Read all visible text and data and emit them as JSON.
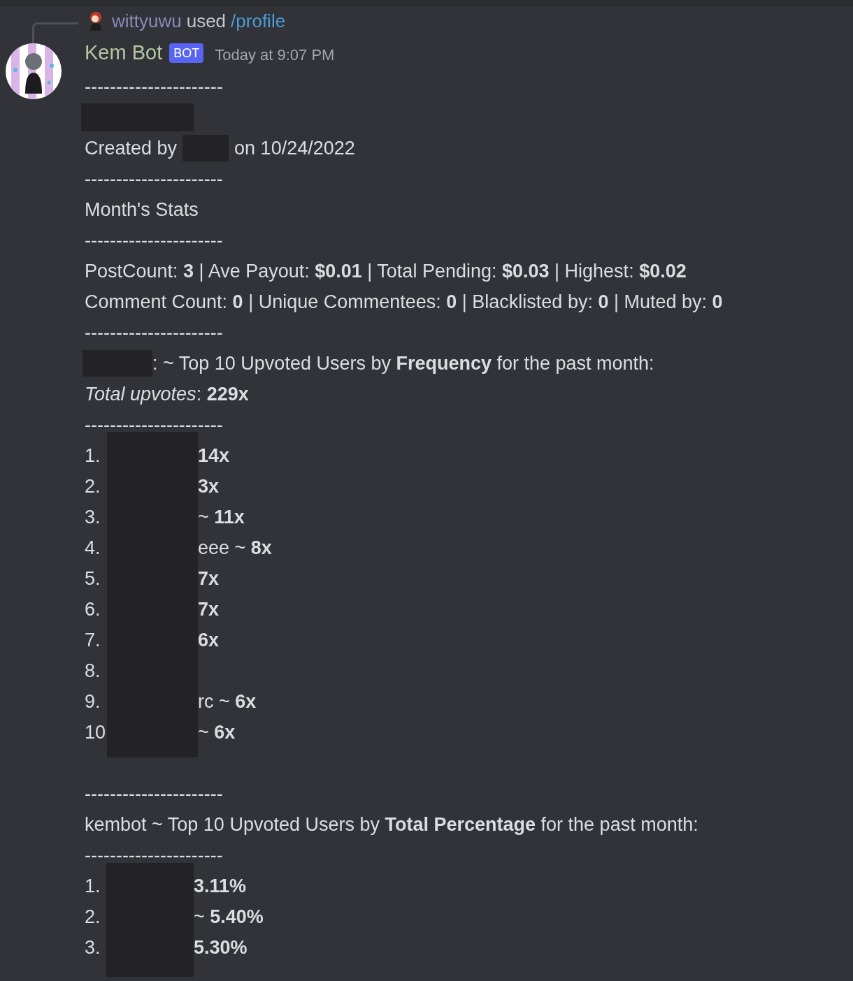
{
  "reply": {
    "username": "wittyuwu",
    "action": "used",
    "command": "/profile"
  },
  "message": {
    "author": "Kem Bot",
    "badge": "BOT",
    "timestamp": "Today at 9:07 PM"
  },
  "lines": [
    {
      "kind": "text",
      "text": "----------------------"
    },
    {
      "kind": "redacted"
    },
    {
      "kind": "split",
      "before": "Created by",
      "after": "on 10/24/2022"
    },
    {
      "kind": "text",
      "text": "----------------------"
    },
    {
      "kind": "text",
      "text": "Month's Stats"
    },
    {
      "kind": "text",
      "text": "----------------------"
    },
    {
      "kind": "text",
      "text": "PostCount: **3** | Ave Payout: **$0.01** | Total Pending: **$0.03** | Highest: **$0.02**"
    },
    {
      "kind": "text",
      "text": "Comment Count: **0** | Unique Commentees: **0** | Blacklisted by: **0** | Muted by: **0**"
    },
    {
      "kind": "text",
      "text": "----------------------"
    },
    {
      "kind": "split",
      "after": ": ~ Top 10 Upvoted Users by **Frequency** for the past month:"
    },
    {
      "kind": "text",
      "text": "*Total upvotes*: **229x**"
    },
    {
      "kind": "text",
      "text": "----------------------"
    },
    {
      "kind": "list",
      "items": [
        {
          "prefix": "1.",
          "suffix": "**14x**"
        },
        {
          "prefix": "2.",
          "suffix": "**3x**"
        },
        {
          "prefix": "3.",
          "suffix": "~ **11x**"
        },
        {
          "prefix": "4.",
          "suffix": "eee ~ **8x**"
        },
        {
          "prefix": "5.",
          "suffix": "**7x**"
        },
        {
          "prefix": "6.",
          "suffix": "**7x**"
        },
        {
          "prefix": "7.",
          "suffix": "**6x**"
        },
        {
          "prefix": "8."
        },
        {
          "prefix": "9.",
          "suffix": "rc ~ **6x**"
        },
        {
          "prefix": "10",
          "suffix": "~ **6x**"
        }
      ]
    },
    {
      "kind": "blank"
    },
    {
      "kind": "text",
      "text": "----------------------"
    },
    {
      "kind": "text",
      "text": "kembot ~ Top 10 Upvoted Users by **Total Percentage** for the past month:"
    },
    {
      "kind": "text",
      "text": "----------------------"
    },
    {
      "kind": "list",
      "items": [
        {
          "prefix": "1.",
          "suffix": "**3.11%**"
        },
        {
          "prefix": "2.",
          "suffix": "~ **5.40%**"
        },
        {
          "prefix": "3.",
          "suffix": "**5.30%**"
        }
      ]
    }
  ]
}
